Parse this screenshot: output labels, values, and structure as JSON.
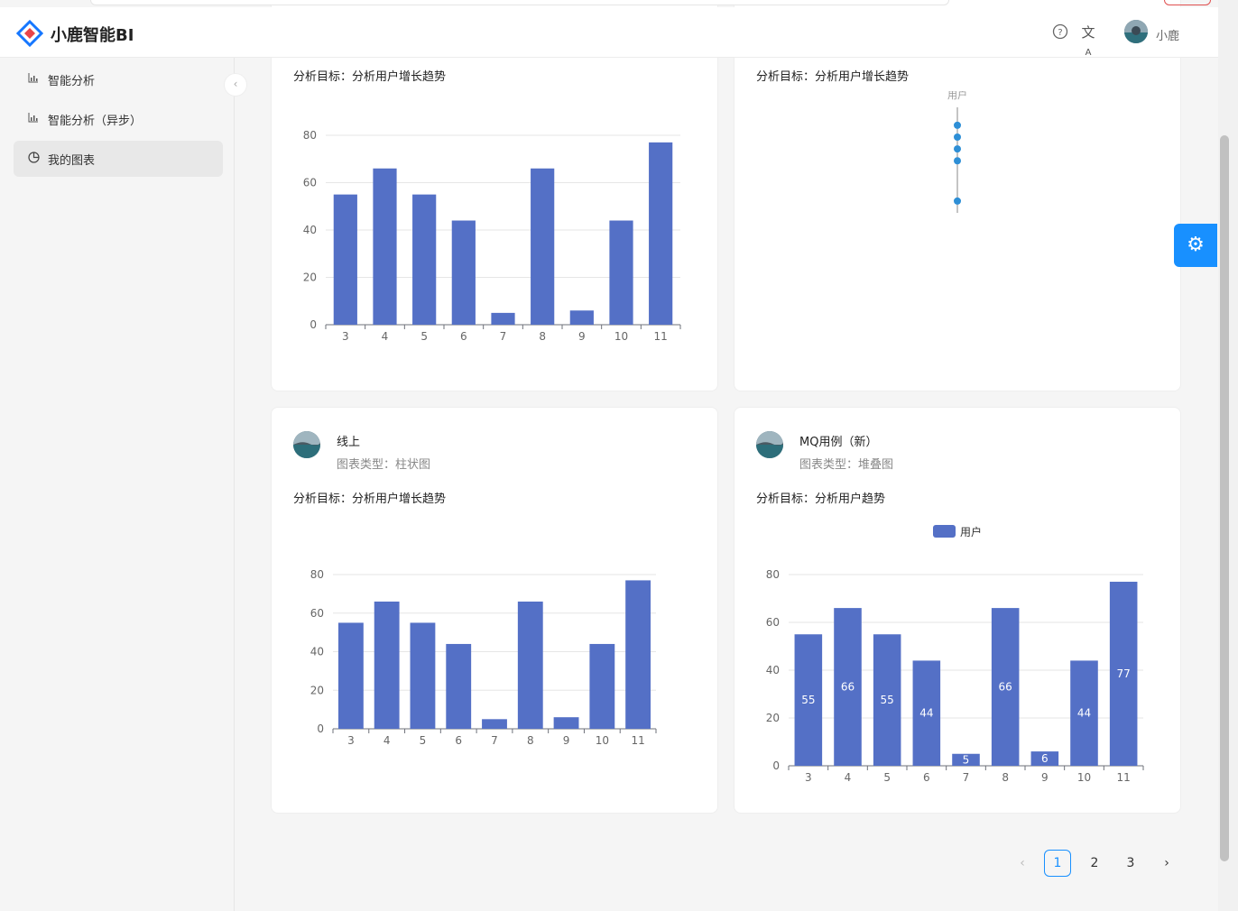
{
  "app": {
    "title": "小鹿智能BI",
    "user_name": "小鹿"
  },
  "sidebar": {
    "items": [
      {
        "label": "智能分析",
        "icon": "bar-chart-icon"
      },
      {
        "label": "智能分析（异步）",
        "icon": "bar-chart-icon"
      },
      {
        "label": "我的图表",
        "icon": "pie-chart-icon",
        "active": true
      }
    ]
  },
  "cards": [
    {
      "title": "",
      "subtitle": "",
      "goal": "分析目标：分析用户增长趋势"
    },
    {
      "title": "",
      "subtitle": "",
      "goal": "分析目标：分析用户增长趋势"
    },
    {
      "title": "线上",
      "subtitle": "图表类型：柱状图",
      "goal": "分析目标：分析用户增长趋势"
    },
    {
      "title": "MQ用例（新）",
      "subtitle": "图表类型：堆叠图",
      "goal": "分析目标：分析用户趋势"
    }
  ],
  "chart_data": [
    {
      "type": "bar",
      "categories": [
        "3",
        "4",
        "5",
        "6",
        "7",
        "8",
        "9",
        "10",
        "11"
      ],
      "values": [
        55,
        66,
        55,
        44,
        5,
        66,
        6,
        44,
        77
      ],
      "ylim": [
        0,
        80
      ],
      "yticks": [
        0,
        20,
        40,
        60,
        80
      ],
      "grid": true
    },
    {
      "type": "scatter",
      "series": [
        {
          "name": "用户",
          "values": [
            77,
            72,
            67,
            62,
            45
          ]
        }
      ]
    },
    {
      "type": "bar",
      "categories": [
        "3",
        "4",
        "5",
        "6",
        "7",
        "8",
        "9",
        "10",
        "11"
      ],
      "values": [
        55,
        66,
        55,
        44,
        5,
        66,
        6,
        44,
        77
      ],
      "ylim": [
        0,
        80
      ],
      "yticks": [
        0,
        20,
        40,
        60,
        80
      ],
      "grid": true
    },
    {
      "type": "bar",
      "categories": [
        "3",
        "4",
        "5",
        "6",
        "7",
        "8",
        "9",
        "10",
        "11"
      ],
      "series": [
        {
          "name": "用户",
          "values": [
            55,
            66,
            55,
            44,
            5,
            66,
            6,
            44,
            77
          ]
        }
      ],
      "ylim": [
        0,
        80
      ],
      "yticks": [
        0,
        20,
        40,
        60,
        80
      ],
      "grid": true,
      "legend": "top-center",
      "data_labels": true
    }
  ],
  "pagination": {
    "pages": [
      "1",
      "2",
      "3"
    ],
    "current": "1",
    "prev": "‹",
    "next": "›"
  },
  "colors": {
    "bar": "#5470c6",
    "accent": "#1890ff",
    "dot": "#2e8fd6"
  }
}
